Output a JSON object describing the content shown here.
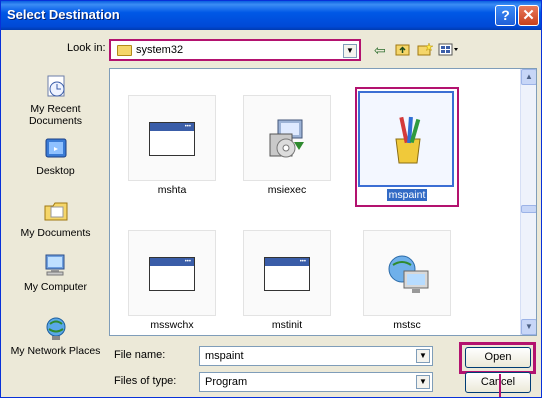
{
  "window": {
    "title": "Select Destination",
    "help_glyph": "?",
    "close_glyph": "✕"
  },
  "toolbar": {
    "lookin_label": "Look in:",
    "lookin_value": "system32",
    "icons": [
      "back-icon",
      "up-folder-icon",
      "new-folder-icon",
      "views-menu-icon"
    ]
  },
  "places": [
    {
      "label": "My Recent Documents",
      "icon": "recent-documents-icon"
    },
    {
      "label": "Desktop",
      "icon": "desktop-icon"
    },
    {
      "label": "My Documents",
      "icon": "my-documents-icon"
    },
    {
      "label": "My Computer",
      "icon": "my-computer-icon"
    },
    {
      "label": "My Network Places",
      "icon": "network-places-icon"
    }
  ],
  "files": [
    {
      "name": "mshta",
      "icon": "window-icon"
    },
    {
      "name": "msiexec",
      "icon": "installer-icon"
    },
    {
      "name": "mspaint",
      "icon": "paint-icon",
      "selected": true
    },
    {
      "name": "msswchx",
      "icon": "window-icon"
    },
    {
      "name": "mstinit",
      "icon": "window-icon"
    },
    {
      "name": "mstsc",
      "icon": "remote-desktop-icon"
    }
  ],
  "form": {
    "filename_label": "File name:",
    "filename_value": "mspaint",
    "filetype_label": "Files of type:",
    "filetype_value": "Program"
  },
  "buttons": {
    "open": "Open",
    "cancel": "Cancel"
  },
  "colors": {
    "highlight_box": "#b3126f",
    "titlebar": "#0058e6",
    "selection": "#316ac5"
  }
}
